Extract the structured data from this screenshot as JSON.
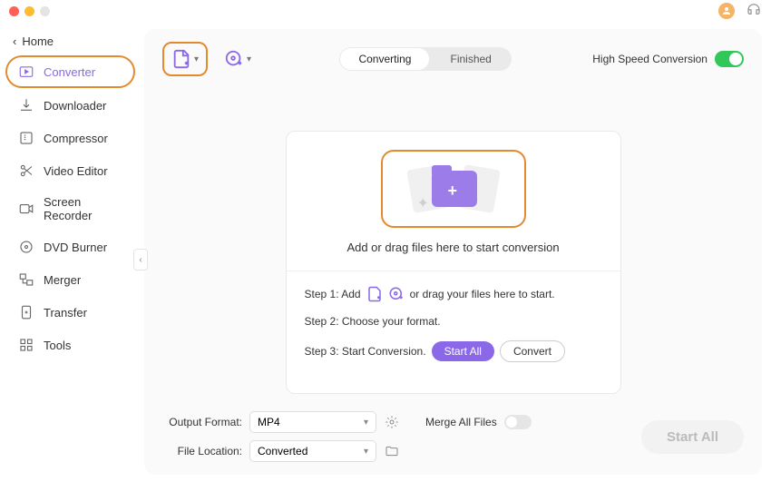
{
  "home_label": "Home",
  "sidebar": {
    "items": [
      {
        "label": "Converter"
      },
      {
        "label": "Downloader"
      },
      {
        "label": "Compressor"
      },
      {
        "label": "Video Editor"
      },
      {
        "label": "Screen Recorder"
      },
      {
        "label": "DVD Burner"
      },
      {
        "label": "Merger"
      },
      {
        "label": "Transfer"
      },
      {
        "label": "Tools"
      }
    ]
  },
  "tabs": {
    "converting": "Converting",
    "finished": "Finished"
  },
  "high_speed_label": "High Speed Conversion",
  "drop": {
    "headline": "Add or drag files here to start conversion",
    "step1_pre": "Step 1: Add",
    "step1_suf": "or drag your files here to start.",
    "step2": "Step 2: Choose your format.",
    "step3_pre": "Step 3: Start Conversion.",
    "start_all_btn": "Start  All",
    "convert_btn": "Convert"
  },
  "footer": {
    "output_format_label": "Output Format:",
    "output_format_value": "MP4",
    "file_location_label": "File Location:",
    "file_location_value": "Converted",
    "merge_label": "Merge All Files",
    "start_all": "Start All"
  }
}
